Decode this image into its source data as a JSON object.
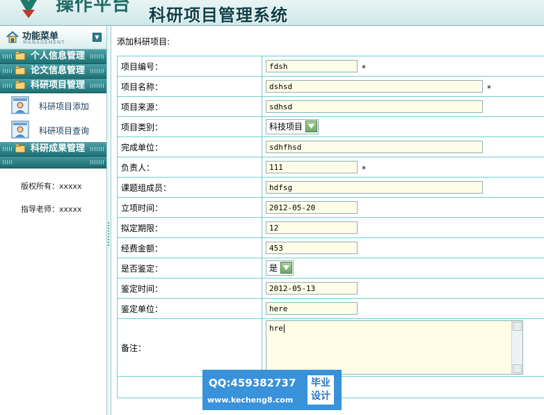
{
  "header": {
    "logo_text": "操作平台",
    "system_title": "科研项目管理系统"
  },
  "sidebar": {
    "menu_title": "功能菜单",
    "menu_subtitle": "MANAGEMENT",
    "sections": [
      {
        "label": "个人信息管理"
      },
      {
        "label": "论文信息管理"
      },
      {
        "label": "科研项目管理"
      }
    ],
    "sub_items": [
      {
        "label": "科研项目添加"
      },
      {
        "label": "科研项目查询"
      }
    ],
    "section_last": {
      "label": "科研成果管理"
    },
    "copyright": "版权所有：xxxxx",
    "advisor": "指导老师：xxxxx"
  },
  "main": {
    "heading": "添加科研项目:",
    "required_mark": "*",
    "fields": {
      "project_no": {
        "label": "项目编号：",
        "value": "fdsh"
      },
      "project_name": {
        "label": "项目名称：",
        "value": "dshsd"
      },
      "project_source": {
        "label": "项目来源：",
        "value": "sdhsd"
      },
      "project_type": {
        "label": "项目类别：",
        "value": "科技项目"
      },
      "completion_unit": {
        "label": "完成单位：",
        "value": "sdhfhsd"
      },
      "leader": {
        "label": "负责人：",
        "value": "111"
      },
      "members": {
        "label": "课题组成员：",
        "value": "hdfsg"
      },
      "start_date": {
        "label": "立项时间：",
        "value": "2012-05-20"
      },
      "planned_period": {
        "label": "拟定期限：",
        "value": "12"
      },
      "funding": {
        "label": "经费金额：",
        "value": "453"
      },
      "appraised": {
        "label": "是否鉴定：",
        "value": "是"
      },
      "appraisal_date": {
        "label": "鉴定时间：",
        "value": "2012-05-13"
      },
      "appraisal_unit": {
        "label": "鉴定单位：",
        "value": "here"
      },
      "remarks": {
        "label": "备注：",
        "value": "hre"
      }
    }
  },
  "watermark": {
    "qq": "QQ:459382737",
    "url": "www.kecheng8.com",
    "badge_line1": "毕业",
    "badge_line2": "设计"
  }
}
